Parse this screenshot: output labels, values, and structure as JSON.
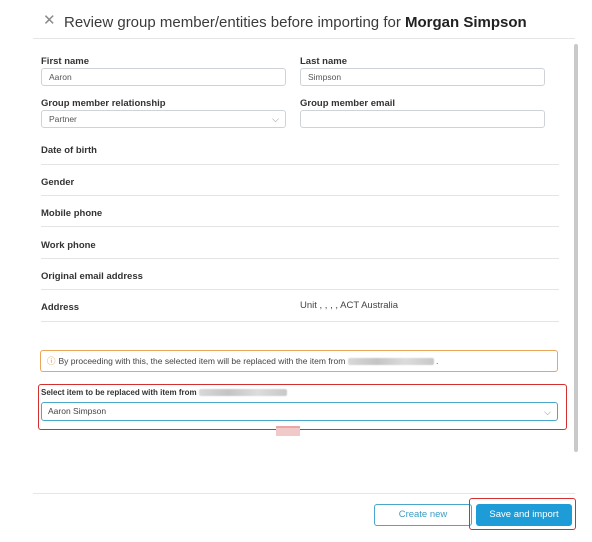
{
  "header": {
    "close_icon": "close-icon",
    "title_prefix": "Review group member/entities before importing for",
    "title_name": "Morgan Simpson"
  },
  "form": {
    "first_name_label": "First name",
    "first_name_value": "Aaron",
    "last_name_label": "Last name",
    "last_name_value": "Simpson",
    "relationship_label": "Group member relationship",
    "relationship_value": "Partner",
    "email_label": "Group member email",
    "email_value": ""
  },
  "details": {
    "dob_label": "Date of birth",
    "gender_label": "Gender",
    "mobile_label": "Mobile phone",
    "work_label": "Work phone",
    "orig_email_label": "Original email address",
    "address_label": "Address",
    "address_value": "Unit , , , , ACT Australia"
  },
  "info": {
    "text": "By proceeding with this, the selected item will be replaced with the item from"
  },
  "replace": {
    "label": "Select item to be replaced with item from",
    "selected": "Aaron Simpson"
  },
  "footer": {
    "create_new": "Create new",
    "save_import": "Save and import"
  },
  "colors": {
    "accent": "#1e9cd7",
    "highlight": "#d32f2f",
    "warning": "#e9a75c"
  }
}
